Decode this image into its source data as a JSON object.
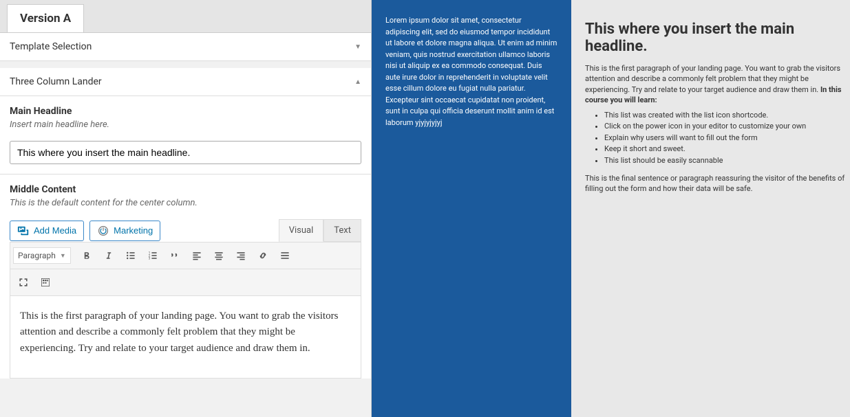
{
  "tab": {
    "label": "Version A"
  },
  "accordion": {
    "template_selection": "Template Selection",
    "three_column": "Three Column Lander"
  },
  "fields": {
    "headline_label": "Main Headline",
    "headline_help": "Insert main headline here.",
    "headline_value": "This where you insert the main headline.",
    "middle_label": "Middle Content",
    "middle_help": "This is the default content for the center column."
  },
  "editor": {
    "add_media": "Add Media",
    "marketing": "Marketing",
    "visual": "Visual",
    "text": "Text",
    "paragraph": "Paragraph",
    "content": "This is the first paragraph of your landing page. You want to grab the visitors attention and describe a commonly felt problem that they might be experiencing. Try and relate to your target audience and draw them in."
  },
  "preview": {
    "lorem": "Lorem ipsum dolor sit amet, consectetur adipiscing elit, sed do eiusmod tempor incididunt ut labore et dolore magna aliqua. Ut enim ad minim veniam, quis nostrud exercitation ullamco laboris nisi ut aliquip ex ea commodo consequat. Duis aute irure dolor in reprehenderit in voluptate velit esse cillum dolore eu fugiat nulla pariatur. Excepteur sint occaecat cupidatat non proident, sunt in culpa qui officia deserunt mollit anim id est laborum yjyjyjyjyj",
    "headline": "This where you insert the main headline.",
    "p1": "This is the first paragraph of your landing page. You want to grab the visitors attention and describe a commonly felt problem that they might be experiencing. Try and relate to your target audience and draw them in. In this course you will learn:",
    "learn_prefix": "In this course you will learn:",
    "list": [
      "This list was created with the list icon shortcode.",
      "Click on the power icon in your editor to customize your own",
      "Explain why users will want to fill out the form",
      "Keep it short and sweet.",
      "This list should be easily scannable"
    ],
    "p2": "This is the final sentence or paragraph reassuring the visitor of the benefits of filling out the form and how their data will be safe."
  }
}
